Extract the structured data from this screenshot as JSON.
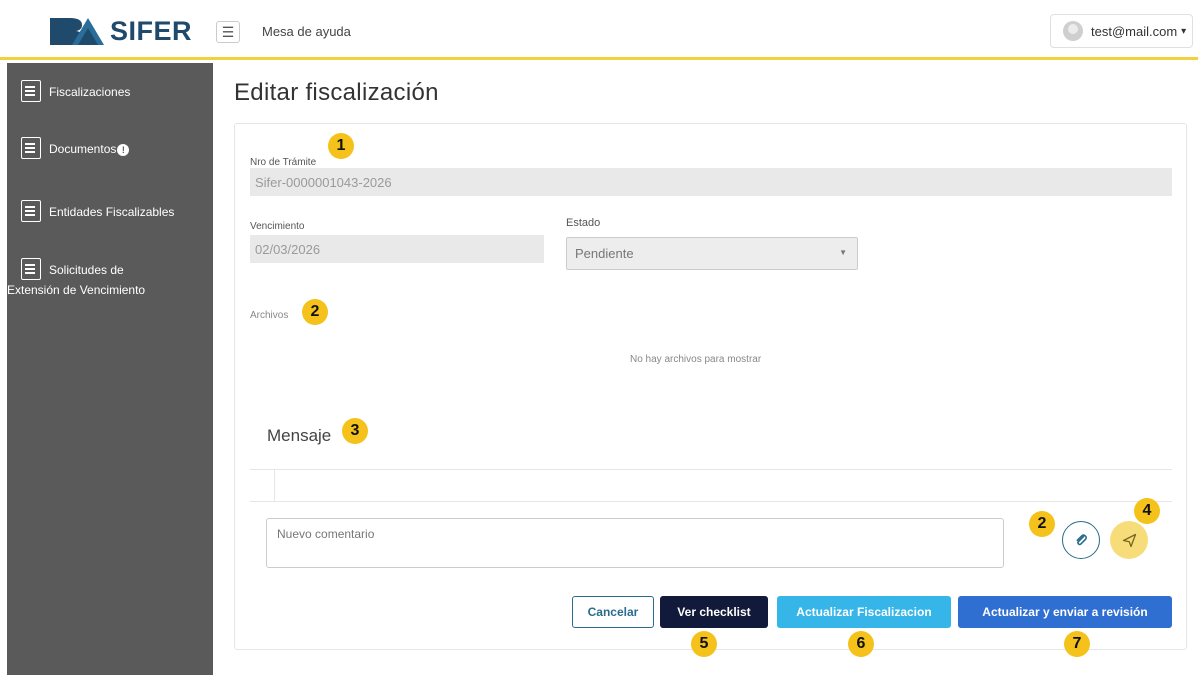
{
  "topbar": {
    "logo_text": "SIFER",
    "title": "Mesa de ayuda",
    "user_email": "test@mail.com"
  },
  "sidebar": {
    "items": [
      {
        "label": "Fiscalizaciones",
        "icon": "document-search-icon"
      },
      {
        "label": "Documentos",
        "icon": "document-icon",
        "badge": "!"
      },
      {
        "label": "Entidades Fiscalizables",
        "icon": "bank-icon"
      },
      {
        "label_line1": "Solicitudes de",
        "label_line2": "Extensión de Vencimiento",
        "icon": "calendar-clock-icon"
      }
    ]
  },
  "page": {
    "title": "Editar fiscalización"
  },
  "form": {
    "tramite_label": "Nro de Trámite",
    "tramite_value": "Sifer-0000001043-2026",
    "vencimiento_label": "Vencimiento",
    "vencimiento_value": "02/03/2026",
    "estado_label": "Estado",
    "estado_value": "Pendiente",
    "archivos_label": "Archivos",
    "archivos_empty": "No hay archivos para mostrar",
    "mensaje_heading": "Mensaje",
    "comentario_placeholder": "Nuevo comentario"
  },
  "buttons": {
    "cancelar": "Cancelar",
    "ver_checklist": "Ver checklist",
    "actualizar": "Actualizar Fiscalizacion",
    "actualizar_enviar": "Actualizar y enviar a revisión"
  },
  "callouts": {
    "c1": "1",
    "c2a": "2",
    "c2b": "2",
    "c3": "3",
    "c4": "4",
    "c5": "5",
    "c6": "6",
    "c7": "7"
  },
  "colors": {
    "accent_yellow": "#f2d23c",
    "callout": "#f4c21b",
    "sidebar_bg": "#5a5a5a",
    "btn_dark": "#111a3b",
    "btn_light_blue": "#35b5e8",
    "btn_blue": "#2f6fd1",
    "brand_dark": "#1f4a6b"
  }
}
